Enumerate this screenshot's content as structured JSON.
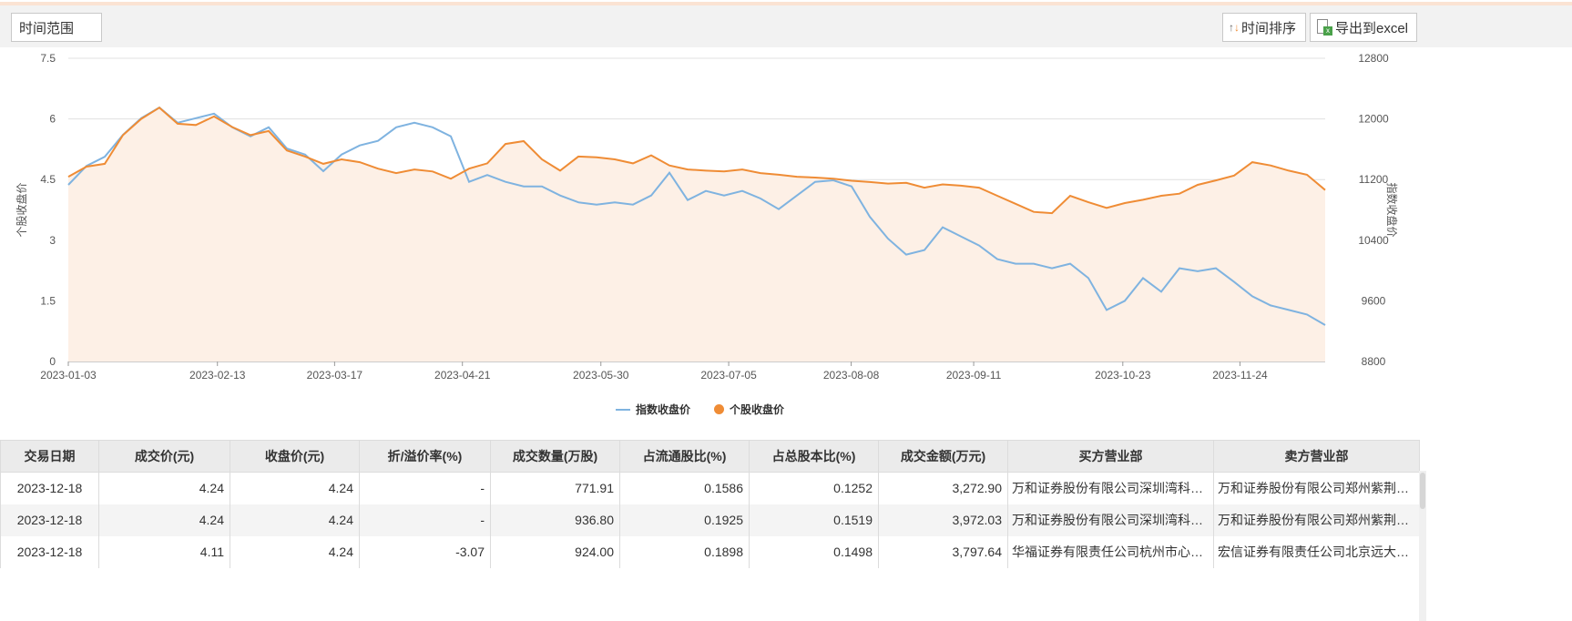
{
  "toolbar": {
    "range_label": "时间范围",
    "sort_label": "时间排序",
    "export_label": "导出到excel"
  },
  "chart_data": {
    "type": "line",
    "ylabel_left": "个股收盘价",
    "ylabel_right": "指数收盘价",
    "ylim_left": [
      0,
      7.5
    ],
    "ylim_right": [
      8800,
      12800
    ],
    "yticks_left": [
      "7.5",
      "6",
      "4.5",
      "3",
      "1.5",
      "0"
    ],
    "yticks_right": [
      "12800",
      "12000",
      "11200",
      "10400",
      "9600",
      "8800"
    ],
    "x_ticks": [
      "2023-01-03",
      "2023-02-13",
      "2023-03-17",
      "2023-04-21",
      "2023-05-30",
      "2023-07-05",
      "2023-08-08",
      "2023-09-11",
      "2023-10-23",
      "2023-11-24"
    ],
    "x_range": [
      "2023-01-03",
      "2023-12-18"
    ],
    "legend": [
      "指数收盘价",
      "个股收盘价"
    ],
    "colors": {
      "index": "#7fb3e0",
      "stock": "#ef8c35",
      "fill": "#fdf0e6"
    },
    "series": [
      {
        "name": "指数收盘价",
        "axis": "right",
        "values": [
          11130,
          11380,
          11500,
          11790,
          12010,
          12150,
          11950,
          12010,
          12070,
          11890,
          11770,
          11890,
          11610,
          11530,
          11310,
          11530,
          11650,
          11710,
          11890,
          11950,
          11890,
          11770,
          11170,
          11260,
          11170,
          11110,
          11110,
          10990,
          10900,
          10870,
          10900,
          10870,
          10990,
          11290,
          10930,
          11050,
          10990,
          11050,
          10950,
          10810,
          10990,
          11170,
          11190,
          11110,
          10710,
          10420,
          10210,
          10270,
          10570,
          10450,
          10330,
          10150,
          10090,
          10090,
          10030,
          10090,
          9900,
          9480,
          9600,
          9900,
          9720,
          10030,
          9990,
          10030,
          9850,
          9660,
          9540,
          9480,
          9420,
          9280
        ]
      },
      {
        "name": "个股收盘价",
        "axis": "left",
        "values": [
          4.57,
          4.82,
          4.89,
          5.6,
          6.0,
          6.28,
          5.88,
          5.85,
          6.06,
          5.8,
          5.6,
          5.7,
          5.22,
          5.07,
          4.89,
          5.0,
          4.93,
          4.77,
          4.66,
          4.75,
          4.7,
          4.52,
          4.77,
          4.9,
          5.38,
          5.45,
          5.0,
          4.72,
          5.07,
          5.05,
          5.0,
          4.9,
          5.1,
          4.85,
          4.75,
          4.72,
          4.7,
          4.75,
          4.66,
          4.62,
          4.57,
          4.55,
          4.52,
          4.47,
          4.44,
          4.4,
          4.42,
          4.3,
          4.38,
          4.35,
          4.3,
          4.1,
          3.9,
          3.7,
          3.67,
          4.1,
          3.94,
          3.8,
          3.92,
          4.0,
          4.1,
          4.15,
          4.37,
          4.48,
          4.6,
          4.93,
          4.85,
          4.72,
          4.62,
          4.24
        ]
      }
    ]
  },
  "table": {
    "headers": [
      "交易日期",
      "成交价(元)",
      "收盘价(元)",
      "折/溢价率(%)",
      "成交数量(万股)",
      "占流通股比(%)",
      "占总股本比(%)",
      "成交金额(万元)",
      "买方营业部",
      "卖方营业部"
    ],
    "rows": [
      [
        "2023-12-18",
        "4.24",
        "4.24",
        "-",
        "771.91",
        "0.1586",
        "0.1252",
        "3,272.90",
        "万和证券股份有限公司深圳湾科技生态园证券营业部",
        "万和证券股份有限公司郑州紫荆山路证券营业部"
      ],
      [
        "2023-12-18",
        "4.24",
        "4.24",
        "-",
        "936.80",
        "0.1925",
        "0.1519",
        "3,972.03",
        "万和证券股份有限公司深圳湾科技生态园证券营业部",
        "万和证券股份有限公司郑州紫荆山路证券营业部"
      ],
      [
        "2023-12-18",
        "4.11",
        "4.24",
        "-3.07",
        "924.00",
        "0.1898",
        "0.1498",
        "3,797.64",
        "华福证券有限责任公司杭州市心南路证券营业部",
        "宏信证券有限责任公司北京远大路证券营业部"
      ]
    ]
  }
}
